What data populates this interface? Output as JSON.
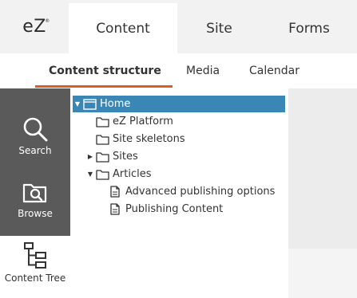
{
  "logo": {
    "text": "eZ",
    "mark": "®"
  },
  "top_tabs": [
    {
      "label": "Content",
      "active": true
    },
    {
      "label": "Site",
      "active": false
    },
    {
      "label": "Forms",
      "active": false
    }
  ],
  "sub_tabs": [
    {
      "label": "Content structure",
      "active": true
    },
    {
      "label": "Media",
      "active": false
    },
    {
      "label": "Calendar",
      "active": false
    }
  ],
  "sidebar": [
    {
      "label": "Search",
      "icon": "search-icon"
    },
    {
      "label": "Browse",
      "icon": "browse-icon"
    },
    {
      "label": "Content Tree",
      "icon": "content-tree-icon",
      "active": true
    }
  ],
  "tree": [
    {
      "label": "Home",
      "toggle": "expanded",
      "icon": "home-window-icon",
      "selected": true
    },
    {
      "label": "eZ Platform",
      "toggle": "none",
      "icon": "folder-icon"
    },
    {
      "label": "Site skeletons",
      "toggle": "none",
      "icon": "folder-icon"
    },
    {
      "label": "Sites",
      "toggle": "collapsed",
      "icon": "folder-icon"
    },
    {
      "label": "Articles",
      "toggle": "expanded",
      "icon": "folder-icon"
    },
    {
      "label": "Advanced publishing options",
      "toggle": "none",
      "icon": "document-icon"
    },
    {
      "label": "Publishing Content",
      "toggle": "none",
      "icon": "document-icon"
    }
  ],
  "colors": {
    "accent": "#e05a28",
    "selected_row": "#3a87b5",
    "sidebar_bg": "#5a5a5a",
    "topbar_bg": "#f2f2f2"
  }
}
